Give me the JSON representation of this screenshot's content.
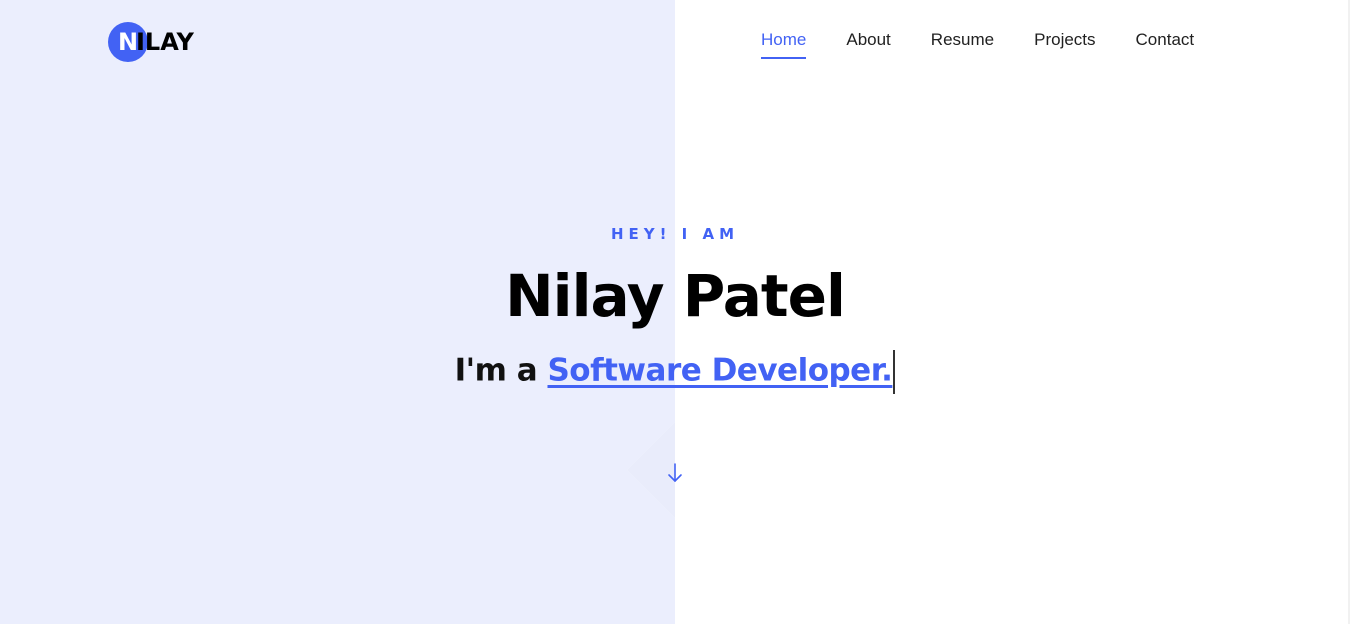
{
  "brand": {
    "logo_initial": "N",
    "logo_rest": "ILAY",
    "accent_color": "#4262f4"
  },
  "nav": {
    "items": [
      {
        "label": "Home",
        "active": true
      },
      {
        "label": "About",
        "active": false
      },
      {
        "label": "Resume",
        "active": false
      },
      {
        "label": "Projects",
        "active": false
      },
      {
        "label": "Contact",
        "active": false
      }
    ]
  },
  "hero": {
    "eyebrow": "HEY! I AM",
    "name": "Nilay Patel",
    "tagline_prefix": "I'm a ",
    "role": "Software Developer.",
    "scroll_icon": "arrow-down-icon"
  }
}
